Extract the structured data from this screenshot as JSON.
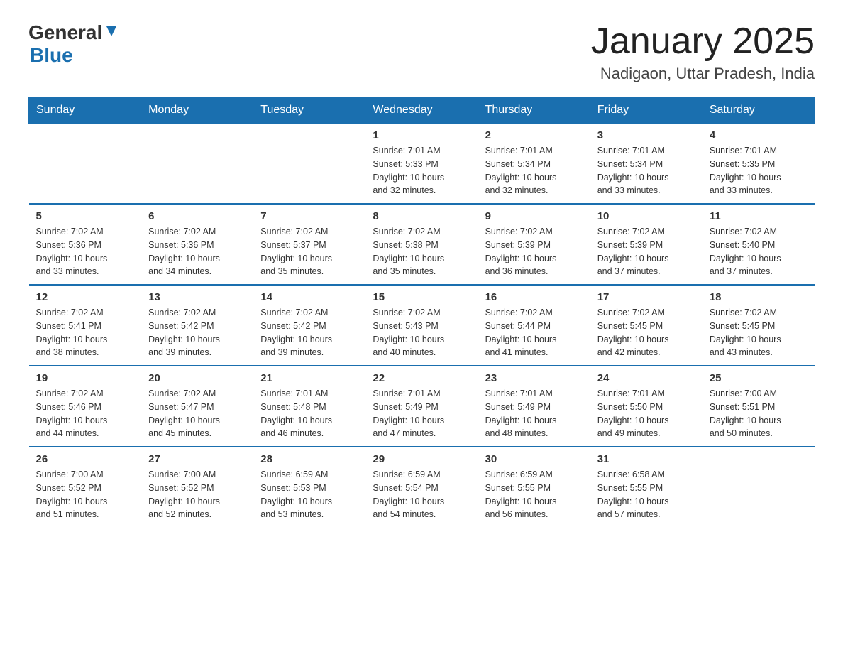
{
  "logo": {
    "general": "General",
    "blue": "Blue",
    "icon": "▼"
  },
  "header": {
    "title": "January 2025",
    "subtitle": "Nadigaon, Uttar Pradesh, India"
  },
  "weekdays": [
    "Sunday",
    "Monday",
    "Tuesday",
    "Wednesday",
    "Thursday",
    "Friday",
    "Saturday"
  ],
  "weeks": [
    [
      {
        "day": "",
        "info": ""
      },
      {
        "day": "",
        "info": ""
      },
      {
        "day": "",
        "info": ""
      },
      {
        "day": "1",
        "info": "Sunrise: 7:01 AM\nSunset: 5:33 PM\nDaylight: 10 hours\nand 32 minutes."
      },
      {
        "day": "2",
        "info": "Sunrise: 7:01 AM\nSunset: 5:34 PM\nDaylight: 10 hours\nand 32 minutes."
      },
      {
        "day": "3",
        "info": "Sunrise: 7:01 AM\nSunset: 5:34 PM\nDaylight: 10 hours\nand 33 minutes."
      },
      {
        "day": "4",
        "info": "Sunrise: 7:01 AM\nSunset: 5:35 PM\nDaylight: 10 hours\nand 33 minutes."
      }
    ],
    [
      {
        "day": "5",
        "info": "Sunrise: 7:02 AM\nSunset: 5:36 PM\nDaylight: 10 hours\nand 33 minutes."
      },
      {
        "day": "6",
        "info": "Sunrise: 7:02 AM\nSunset: 5:36 PM\nDaylight: 10 hours\nand 34 minutes."
      },
      {
        "day": "7",
        "info": "Sunrise: 7:02 AM\nSunset: 5:37 PM\nDaylight: 10 hours\nand 35 minutes."
      },
      {
        "day": "8",
        "info": "Sunrise: 7:02 AM\nSunset: 5:38 PM\nDaylight: 10 hours\nand 35 minutes."
      },
      {
        "day": "9",
        "info": "Sunrise: 7:02 AM\nSunset: 5:39 PM\nDaylight: 10 hours\nand 36 minutes."
      },
      {
        "day": "10",
        "info": "Sunrise: 7:02 AM\nSunset: 5:39 PM\nDaylight: 10 hours\nand 37 minutes."
      },
      {
        "day": "11",
        "info": "Sunrise: 7:02 AM\nSunset: 5:40 PM\nDaylight: 10 hours\nand 37 minutes."
      }
    ],
    [
      {
        "day": "12",
        "info": "Sunrise: 7:02 AM\nSunset: 5:41 PM\nDaylight: 10 hours\nand 38 minutes."
      },
      {
        "day": "13",
        "info": "Sunrise: 7:02 AM\nSunset: 5:42 PM\nDaylight: 10 hours\nand 39 minutes."
      },
      {
        "day": "14",
        "info": "Sunrise: 7:02 AM\nSunset: 5:42 PM\nDaylight: 10 hours\nand 39 minutes."
      },
      {
        "day": "15",
        "info": "Sunrise: 7:02 AM\nSunset: 5:43 PM\nDaylight: 10 hours\nand 40 minutes."
      },
      {
        "day": "16",
        "info": "Sunrise: 7:02 AM\nSunset: 5:44 PM\nDaylight: 10 hours\nand 41 minutes."
      },
      {
        "day": "17",
        "info": "Sunrise: 7:02 AM\nSunset: 5:45 PM\nDaylight: 10 hours\nand 42 minutes."
      },
      {
        "day": "18",
        "info": "Sunrise: 7:02 AM\nSunset: 5:45 PM\nDaylight: 10 hours\nand 43 minutes."
      }
    ],
    [
      {
        "day": "19",
        "info": "Sunrise: 7:02 AM\nSunset: 5:46 PM\nDaylight: 10 hours\nand 44 minutes."
      },
      {
        "day": "20",
        "info": "Sunrise: 7:02 AM\nSunset: 5:47 PM\nDaylight: 10 hours\nand 45 minutes."
      },
      {
        "day": "21",
        "info": "Sunrise: 7:01 AM\nSunset: 5:48 PM\nDaylight: 10 hours\nand 46 minutes."
      },
      {
        "day": "22",
        "info": "Sunrise: 7:01 AM\nSunset: 5:49 PM\nDaylight: 10 hours\nand 47 minutes."
      },
      {
        "day": "23",
        "info": "Sunrise: 7:01 AM\nSunset: 5:49 PM\nDaylight: 10 hours\nand 48 minutes."
      },
      {
        "day": "24",
        "info": "Sunrise: 7:01 AM\nSunset: 5:50 PM\nDaylight: 10 hours\nand 49 minutes."
      },
      {
        "day": "25",
        "info": "Sunrise: 7:00 AM\nSunset: 5:51 PM\nDaylight: 10 hours\nand 50 minutes."
      }
    ],
    [
      {
        "day": "26",
        "info": "Sunrise: 7:00 AM\nSunset: 5:52 PM\nDaylight: 10 hours\nand 51 minutes."
      },
      {
        "day": "27",
        "info": "Sunrise: 7:00 AM\nSunset: 5:52 PM\nDaylight: 10 hours\nand 52 minutes."
      },
      {
        "day": "28",
        "info": "Sunrise: 6:59 AM\nSunset: 5:53 PM\nDaylight: 10 hours\nand 53 minutes."
      },
      {
        "day": "29",
        "info": "Sunrise: 6:59 AM\nSunset: 5:54 PM\nDaylight: 10 hours\nand 54 minutes."
      },
      {
        "day": "30",
        "info": "Sunrise: 6:59 AM\nSunset: 5:55 PM\nDaylight: 10 hours\nand 56 minutes."
      },
      {
        "day": "31",
        "info": "Sunrise: 6:58 AM\nSunset: 5:55 PM\nDaylight: 10 hours\nand 57 minutes."
      },
      {
        "day": "",
        "info": ""
      }
    ]
  ],
  "accent_color": "#1a6faf"
}
